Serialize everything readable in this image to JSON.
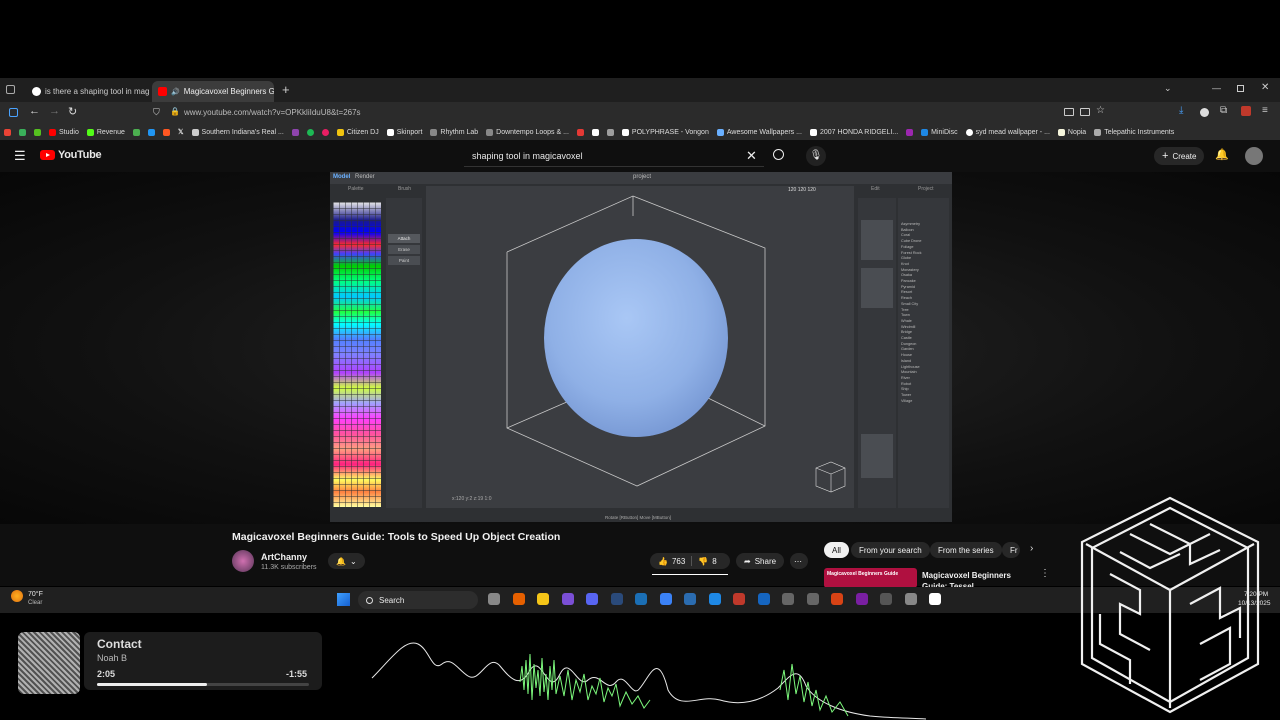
{
  "browser": {
    "tabs": [
      {
        "label": "is there a shaping tool in magic",
        "active": false
      },
      {
        "label": "Magicavoxel Beginners Gui",
        "active": true
      }
    ],
    "url": "www.youtube.com/watch?v=OPKkliIduU8&t=267s",
    "bookmarks": [
      "Studio",
      "Revenue",
      "Southern Indiana's Real ...",
      "Citizen DJ",
      "Skinport",
      "Rhythm Lab",
      "Downtempo Loops & ...",
      "POLYPHRASE - Vongon",
      "Awesome Wallpapers ...",
      "2007 HONDA RIDGELI...",
      "MiniDisc",
      "syd mead wallpaper - ...",
      "Nopia",
      "Telepathic Instruments"
    ]
  },
  "youtube": {
    "logo_text": "YouTube",
    "search_query": "shaping tool in magicavoxel",
    "create_label": "Create",
    "video_title": "Magicavoxel Beginners Guide: Tools to Speed Up Object Creation",
    "channel_name": "ArtChanny",
    "subscribers": "11.3K subscribers",
    "likes": "763",
    "dislikes": "8",
    "share_label": "Share",
    "chips": [
      "All",
      "From your search",
      "From the series",
      "Fr"
    ],
    "sidebar_video_title": "Magicavoxel Beginners Guide: Tessel",
    "sidebar_thumb_text": "Magicavoxel Beginners Guide"
  },
  "magicavoxel": {
    "tabs": [
      "Model",
      "Render"
    ],
    "project_label": "project",
    "palette_label": "Palette",
    "brush_label": "Brush",
    "edit_label": "Edit",
    "project_panel_label": "Project",
    "dims": [
      "120",
      "120",
      "120"
    ],
    "brush_modes": [
      "Attach",
      "Erase",
      "Paint"
    ],
    "status_text": "Rotate [RButton]  Move [MButton]",
    "coords": "x:120  y:2  z:19  1:0",
    "project_items": [
      "Asymmetry",
      "Balloon",
      "Coral",
      "Cube Drone",
      "Foliage",
      "Forest Rock",
      "Globe",
      "Knot",
      "Monastery",
      "Osaka",
      "Pancake",
      "Pyramid",
      "Resort",
      "Reach",
      "Small City",
      "Tree",
      "Town",
      "Whale",
      "Windmill",
      "Bridge",
      "Castle",
      "Dungeon",
      "Garden",
      "House",
      "Island",
      "Lighthouse",
      "Mountain",
      "River",
      "Robot",
      "Ship",
      "Tower",
      "Village"
    ]
  },
  "taskbar": {
    "weather_temp": "70°F",
    "weather_cond": "Clear",
    "search_label": "Search",
    "time": "7:20 PM",
    "date": "10/13/2025"
  },
  "music": {
    "title": "Contact",
    "artist": "Noah B",
    "elapsed": "2:05",
    "remaining": "-1:55",
    "progress": 0.52
  }
}
